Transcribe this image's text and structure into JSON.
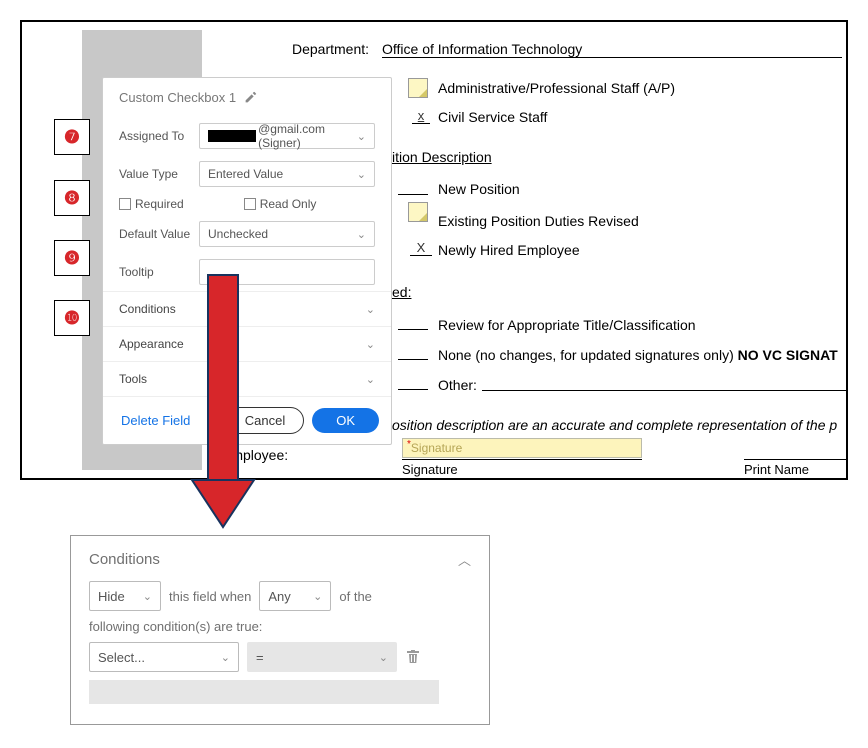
{
  "header": {
    "department_label": "Department:",
    "department_value": "Office of Information Technology"
  },
  "staff_type": {
    "ap": "Administrative/Professional Staff (A/P)",
    "civil": "Civil Service Staff",
    "civil_mark": "x"
  },
  "pos_desc": {
    "heading_fragment": "ition Description",
    "new_position": "New Position",
    "existing": "Existing Position Duties Revised",
    "newly_hired": "Newly Hired Employee",
    "newly_hired_mark": "X"
  },
  "ed_section": {
    "heading_suffix": "ed:",
    "review": "Review for Appropriate Title/Classification",
    "none": "None (no changes, for updated signatures only)",
    "no_vc_frag": "NO VC SIGNAT",
    "other_label": "Other:"
  },
  "cert_line": "osition description are an accurate and complete representation of the p",
  "sig": {
    "employee_label": "Employee:",
    "sig_field_label": "Signature",
    "signature_caption": "Signature",
    "print_name_caption": "Print Name"
  },
  "popup": {
    "title": "Custom Checkbox 1",
    "assigned_to_label": "Assigned To",
    "assigned_to_value_suffix": "@gmail.com (Signer)",
    "value_type_label": "Value Type",
    "value_type_value": "Entered Value",
    "required_label": "Required",
    "readonly_label": "Read Only",
    "default_value_label": "Default Value",
    "default_value_value": "Unchecked",
    "tooltip_label": "Tooltip",
    "conditions_label": "Conditions",
    "appearance_label": "Appearance",
    "tools_label": "Tools",
    "delete_label": "Delete Field",
    "cancel_label": "Cancel",
    "ok_label": "OK"
  },
  "badges": {
    "b7": "❼",
    "b8": "❽",
    "b9": "❾",
    "b10": "❿"
  },
  "cond_panel": {
    "title": "Conditions",
    "hide_value": "Hide",
    "text1": "this field when",
    "any_value": "Any",
    "text2": "of the",
    "subline": "following condition(s) are true:",
    "select_placeholder": "Select...",
    "operator_value": "="
  }
}
